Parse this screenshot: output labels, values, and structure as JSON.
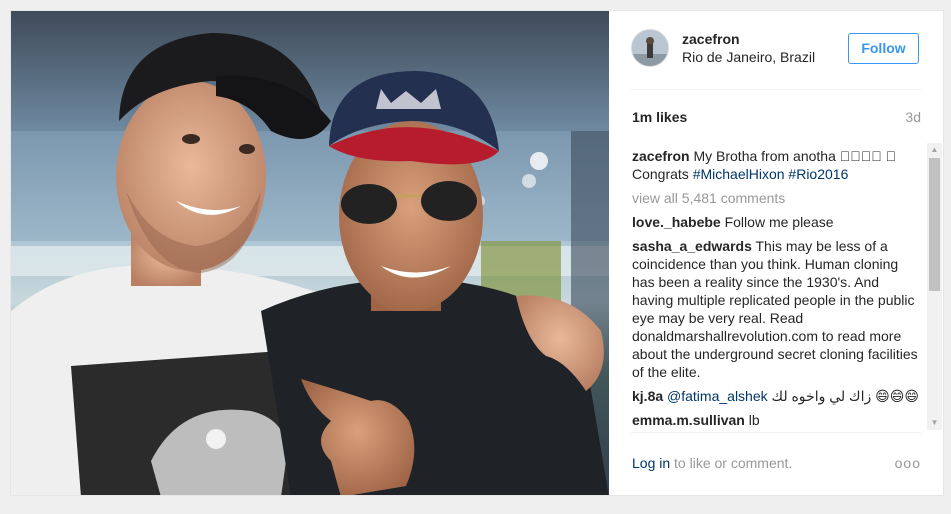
{
  "post": {
    "username": "zacefron",
    "location": "Rio de Janeiro, Brazil",
    "follow_label": "Follow",
    "likes": "1m likes",
    "age": "3d"
  },
  "comments": {
    "caption_user": "zacefron",
    "caption_text": "My Brotha from anotha 🏻🏻🏻🏻 🏻 Congrats",
    "caption_tag1": "#MichaelHixon",
    "caption_tag2": "#Rio2016",
    "view_all": "view all 5,481 comments",
    "items": [
      {
        "user": "love._habebe",
        "text": "Follow me please"
      },
      {
        "user": "sasha_a_edwards",
        "text": "This may be less of a coincidence than you think. Human cloning has been a reality since the 1930's. And having multiple replicated people in the public eye may be very real. Read donaldmarshallrevolution.com to read more about the underground secret cloning facilities of the elite."
      },
      {
        "user": "kj.8a",
        "mention": "@fatima_alshek",
        "text": "زاك لي واخوه لك 😄😄😄"
      },
      {
        "user": "emma.m.sullivan",
        "text": "lb"
      }
    ]
  },
  "footer": {
    "login_link": "Log in",
    "login_rest": " to like or comment.",
    "more_label": "ooo"
  },
  "colors": {
    "accent": "#3897f0",
    "link": "#003569",
    "muted": "#999999"
  },
  "icons": {
    "scroll_up": "scroll-up-arrow-icon",
    "scroll_down": "scroll-down-arrow-icon",
    "more": "more-options-icon"
  }
}
